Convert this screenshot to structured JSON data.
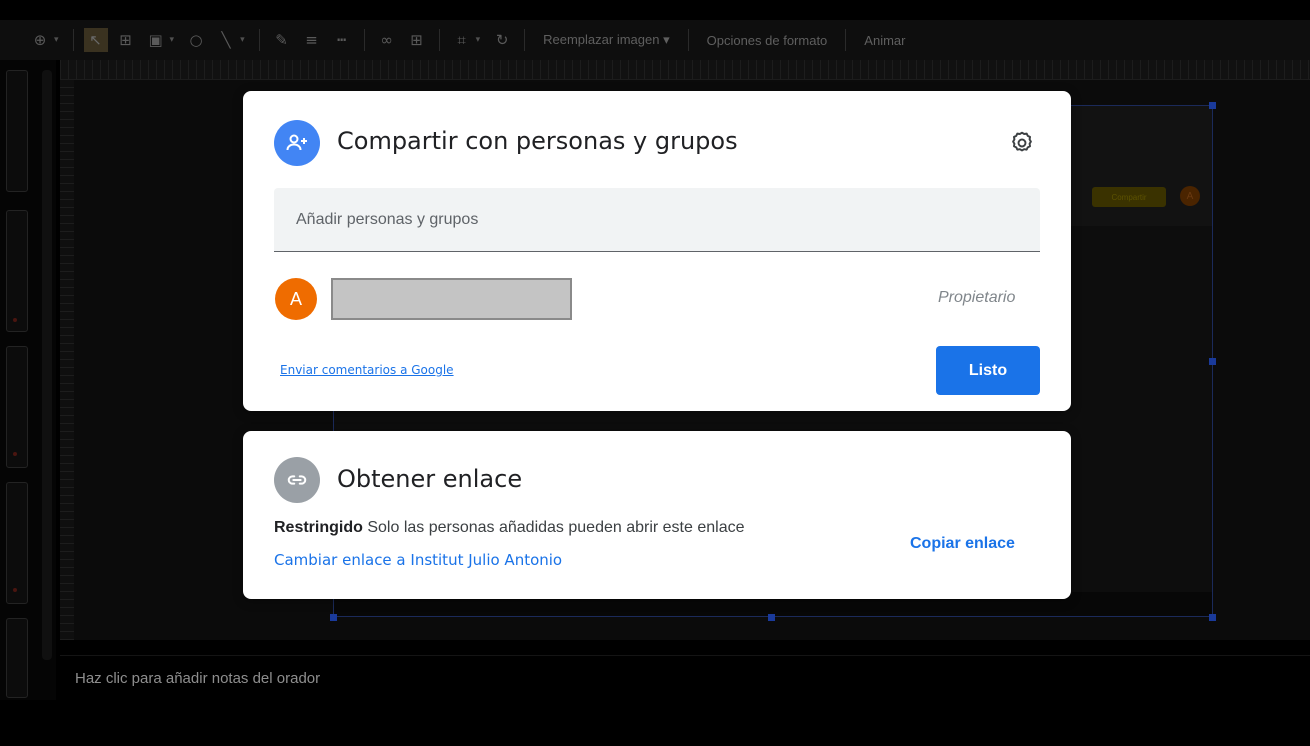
{
  "toolbar": {
    "replace_image_label": "Reemplazar imagen ▾",
    "format_options_label": "Opciones de formato",
    "animate_label": "Animar"
  },
  "notes": {
    "placeholder": "Haz clic para añadir notas del orador"
  },
  "background_shot": {
    "share_chip_label": "Compartir",
    "avatar_letter": "A"
  },
  "share_dialog": {
    "title": "Compartir con personas y grupos",
    "add_field_placeholder": "Añadir personas y grupos",
    "person": {
      "avatar_letter": "A",
      "role": "Propietario"
    },
    "feedback_link": "Enviar comentarios a Google",
    "done_button": "Listo"
  },
  "link_dialog": {
    "title": "Obtener enlace",
    "access_level": "Restringido",
    "access_description": "Solo las personas añadidas pueden abrir este enlace",
    "change_link": "Cambiar enlace a Institut Julio Antonio",
    "copy_link": "Copiar enlace"
  },
  "icons": {
    "share": "person-add-icon",
    "settings": "gear-icon",
    "link": "link-icon"
  },
  "colors": {
    "accent": "#1a73e8",
    "share_icon_bg": "#4285f4",
    "link_icon_bg": "#9aa0a6",
    "avatar_bg": "#ef6c00",
    "redaction": "#c4c4c4"
  }
}
